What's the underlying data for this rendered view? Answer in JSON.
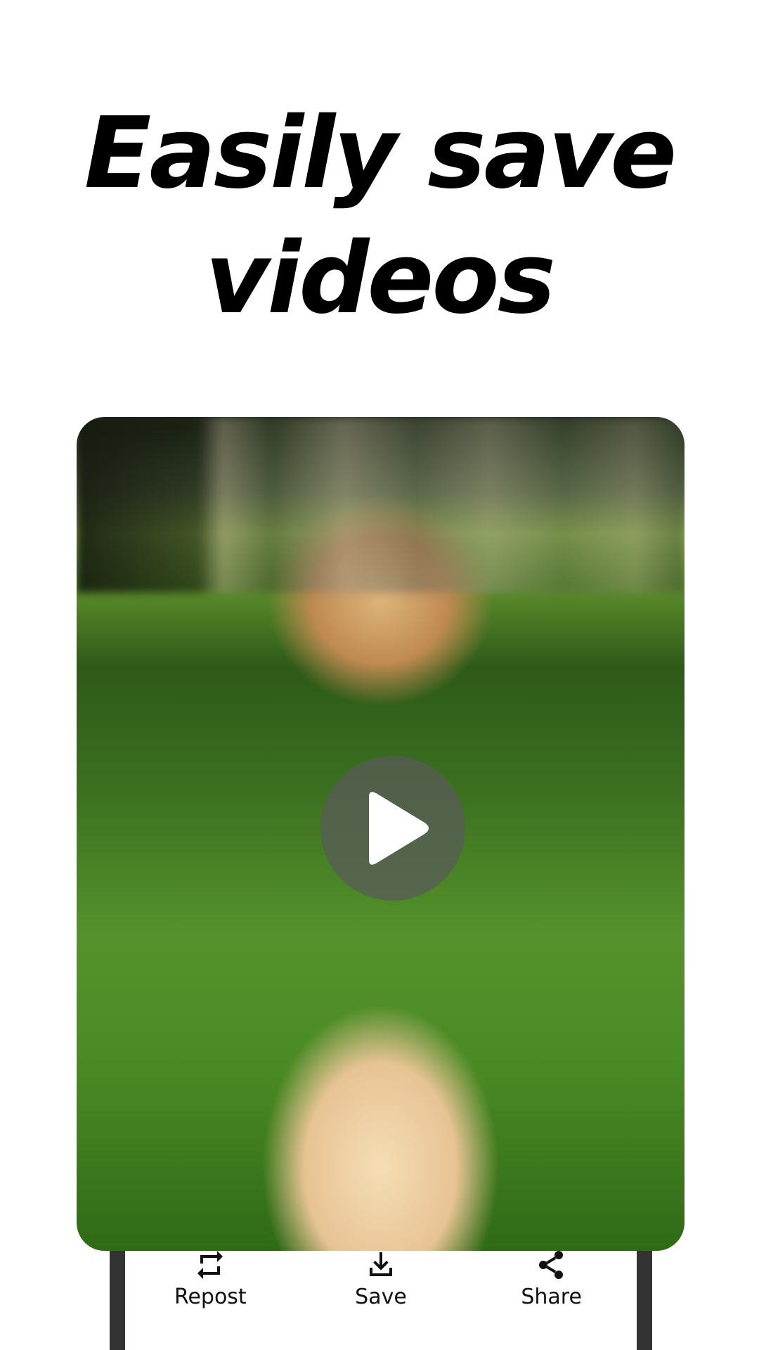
{
  "headline": {
    "line1": "Easily save",
    "line2": "videos"
  },
  "media": {
    "play_icon": "play-icon"
  },
  "actions": [
    {
      "label": "Repost",
      "icon": "repost-icon"
    },
    {
      "label": "Save",
      "icon": "download-icon"
    },
    {
      "label": "Share",
      "icon": "share-icon"
    }
  ],
  "colors": {
    "background": "#ffffff",
    "headline": "#000000",
    "frame": "#333333",
    "play_overlay": "#5a5a5a"
  }
}
